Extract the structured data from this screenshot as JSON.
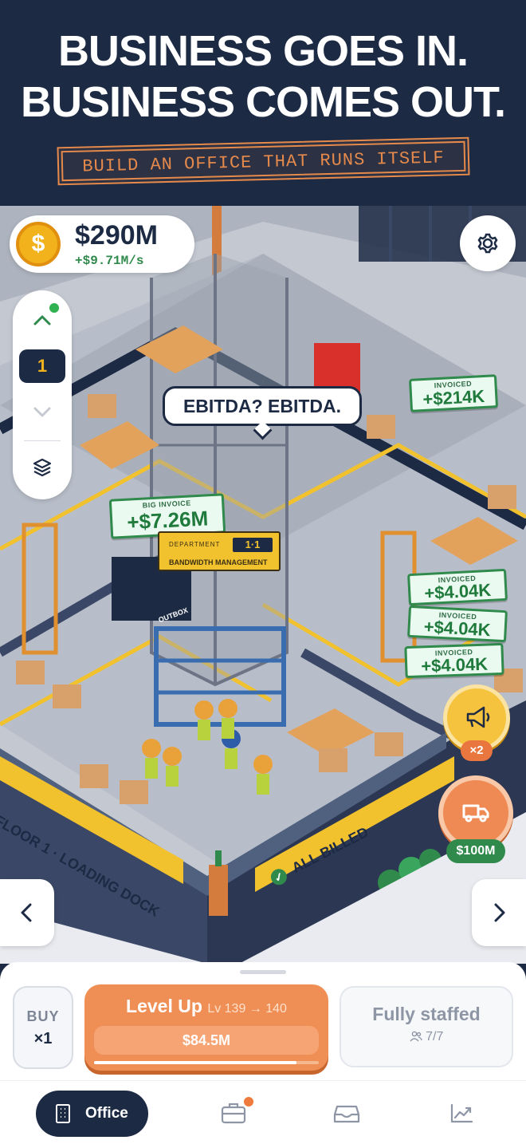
{
  "header": {
    "headline_line1": "BUSINESS GOES IN.",
    "headline_line2": "BUSINESS COMES OUT.",
    "tagline": "BUILD AN OFFICE THAT RUNS ITSELF"
  },
  "hud": {
    "money": "$290M",
    "income_rate": "+$9.71M/s",
    "coin_symbol": "$",
    "settings_icon": "gear-icon"
  },
  "floor_selector": {
    "current_floor": "1",
    "up_icon": "chevron-up-icon",
    "down_icon": "chevron-down-icon",
    "layers_icon": "layers-icon"
  },
  "scene": {
    "speech_bubble": "EBITDA? EBITDA.",
    "department": {
      "label": "DEPARTMENT",
      "code": "1·1",
      "name": "BANDWIDTH MANAGEMENT"
    },
    "floor_sign": "FLOOR 1 · LOADING DOCK",
    "status_sign": "ALL BILLED",
    "outbox_label": "OUTBOX",
    "invoices": [
      {
        "label": "BIG INVOICE",
        "amount": "+$7.26M"
      },
      {
        "label": "INVOICED",
        "amount": "+$214K"
      },
      {
        "label": "INVOICED",
        "amount": "+$4.04K"
      },
      {
        "label": "INVOICED",
        "amount": "+$4.04K"
      },
      {
        "label": "INVOICED",
        "amount": "+$4.04K"
      }
    ]
  },
  "boosts": {
    "megaphone_multiplier": "×2",
    "truck_price": "$100M"
  },
  "actions": {
    "buy_label": "BUY",
    "buy_quantity": "×1",
    "level_up_label": "Level Up",
    "level_range": "Lv 139 → 140",
    "level_up_price": "$84.5M",
    "level_progress": 0.9,
    "staff_status": "Fully staffed",
    "staff_count": "7/7"
  },
  "tabs": [
    {
      "label": "Office",
      "icon": "building-icon",
      "active": true
    },
    {
      "label": "",
      "icon": "briefcase-icon",
      "badge": true
    },
    {
      "label": "",
      "icon": "inbox-icon"
    },
    {
      "label": "",
      "icon": "chart-trend-icon"
    }
  ],
  "colors": {
    "navy": "#1d2a44",
    "orange": "#ef8f55",
    "green": "#2f8a4c",
    "gold": "#f2b21c"
  }
}
